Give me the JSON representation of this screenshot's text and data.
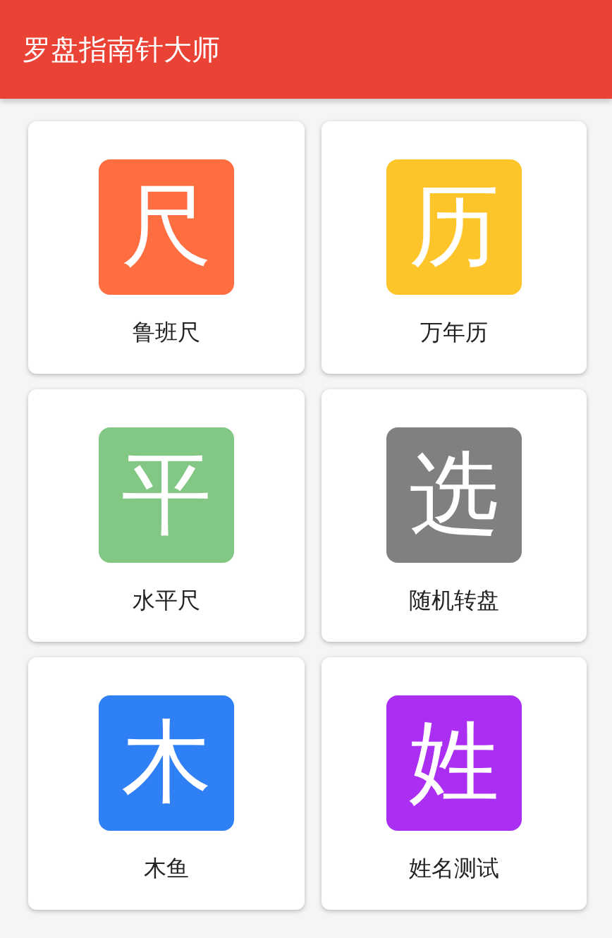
{
  "app_bar": {
    "title": "罗盘指南针大师"
  },
  "tools": [
    {
      "glyph": "尺",
      "label": "鲁班尺",
      "color": "#ff6e40"
    },
    {
      "glyph": "历",
      "label": "万年历",
      "color": "#fec52a"
    },
    {
      "glyph": "平",
      "label": "水平尺",
      "color": "#82c784"
    },
    {
      "glyph": "选",
      "label": "随机转盘",
      "color": "#808080"
    },
    {
      "glyph": "木",
      "label": "木鱼",
      "color": "#2f7ff5"
    },
    {
      "glyph": "姓",
      "label": "姓名测试",
      "color": "#ab2ff2"
    }
  ]
}
